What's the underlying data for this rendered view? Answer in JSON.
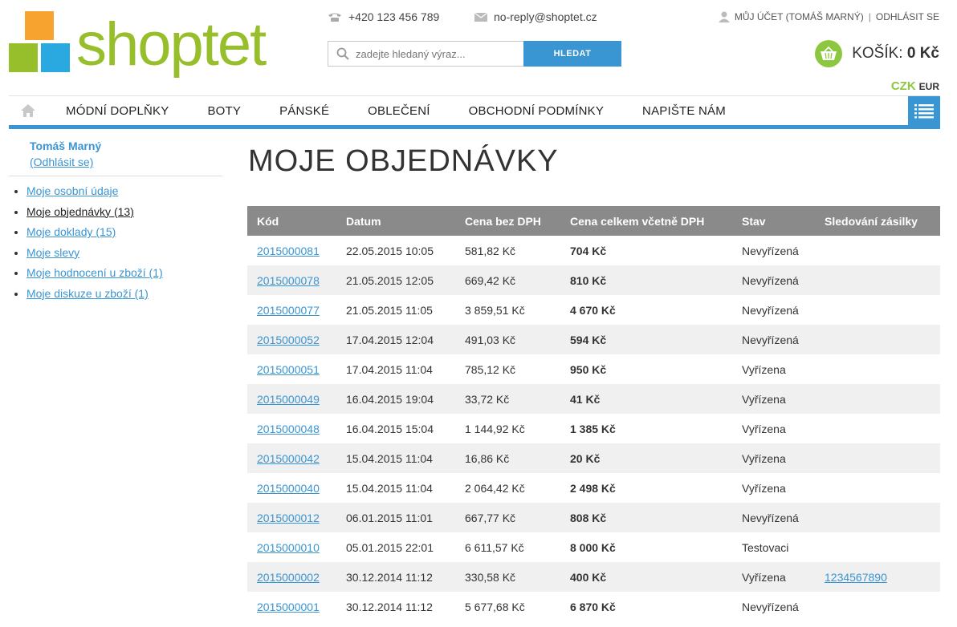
{
  "header": {
    "logo_text": "shoptet",
    "phone": "+420 123 456 789",
    "email": "no-reply@shoptet.cz",
    "account_label": "Můj účet (Tomáš Marný)",
    "logout_label": "Odhlásit se",
    "search_placeholder": "zadejte hledaný výraz...",
    "search_button": "HLEDAT",
    "cart_label": "KOŠÍK:",
    "cart_value": "0 Kč",
    "currency_active": "CZK",
    "currency_other": "EUR"
  },
  "nav": {
    "items": [
      "Módní doplňky",
      "Boty",
      "Pánské",
      "Oblečení",
      "Obchodní podmínky",
      "Napište nám"
    ]
  },
  "sidebar": {
    "user_name": "Tomáš Marný",
    "logout": "(Odhlásit se)",
    "items": [
      "Moje osobní údaje",
      "Moje objednávky (13)",
      "Moje doklady (15)",
      "Moje slevy",
      "Moje hodnocení u zboží (1)",
      "Moje diskuze u zboží (1)"
    ]
  },
  "page": {
    "title": "MOJE OBJEDNÁVKY"
  },
  "table": {
    "headers": [
      "Kód",
      "Datum",
      "Cena bez DPH",
      "Cena celkem včetně DPH",
      "Stav",
      "Sledování zásilky"
    ],
    "rows": [
      [
        "2015000081",
        "22.05.2015 10:05",
        "581,82 Kč",
        "704 Kč",
        "Nevyřízená",
        ""
      ],
      [
        "2015000078",
        "21.05.2015 12:05",
        "669,42 Kč",
        "810 Kč",
        "Nevyřízená",
        ""
      ],
      [
        "2015000077",
        "21.05.2015 11:05",
        "3 859,51 Kč",
        "4 670 Kč",
        "Nevyřízená",
        ""
      ],
      [
        "2015000052",
        "17.04.2015 12:04",
        "491,03 Kč",
        "594 Kč",
        "Nevyřízená",
        ""
      ],
      [
        "2015000051",
        "17.04.2015 11:04",
        "785,12 Kč",
        "950 Kč",
        "Vyřízena",
        ""
      ],
      [
        "2015000049",
        "16.04.2015 19:04",
        "33,72 Kč",
        "41 Kč",
        "Vyřízena",
        ""
      ],
      [
        "2015000048",
        "16.04.2015 15:04",
        "1 144,92 Kč",
        "1 385 Kč",
        "Vyřízena",
        ""
      ],
      [
        "2015000042",
        "15.04.2015 11:04",
        "16,86 Kč",
        "20 Kč",
        "Vyřízena",
        ""
      ],
      [
        "2015000040",
        "15.04.2015 11:04",
        "2 064,42 Kč",
        "2 498 Kč",
        "Vyřízena",
        ""
      ],
      [
        "2015000012",
        "06.01.2015 11:01",
        "667,77 Kč",
        "808 Kč",
        "Nevyřízená",
        ""
      ],
      [
        "2015000010",
        "05.01.2015 22:01",
        "6 611,57 Kč",
        "8 000 Kč",
        "Testovaci",
        ""
      ],
      [
        "2015000002",
        "30.12.2014 11:12",
        "330,58 Kč",
        "400 Kč",
        "Vyřízena",
        "1234567890"
      ],
      [
        "2015000001",
        "30.12.2014 11:12",
        "5 677,68 Kč",
        "6 870 Kč",
        "Nevyřízená",
        ""
      ]
    ]
  },
  "colors": {
    "accent": "#3a95d3",
    "brand_green": "#97bf2c",
    "cart_green": "#8dc63f",
    "table_header": "#8a8a8a"
  },
  "icons": [
    "phone-icon",
    "mail-icon",
    "user-icon",
    "search-icon",
    "basket-icon",
    "home-icon",
    "menu-icon"
  ]
}
